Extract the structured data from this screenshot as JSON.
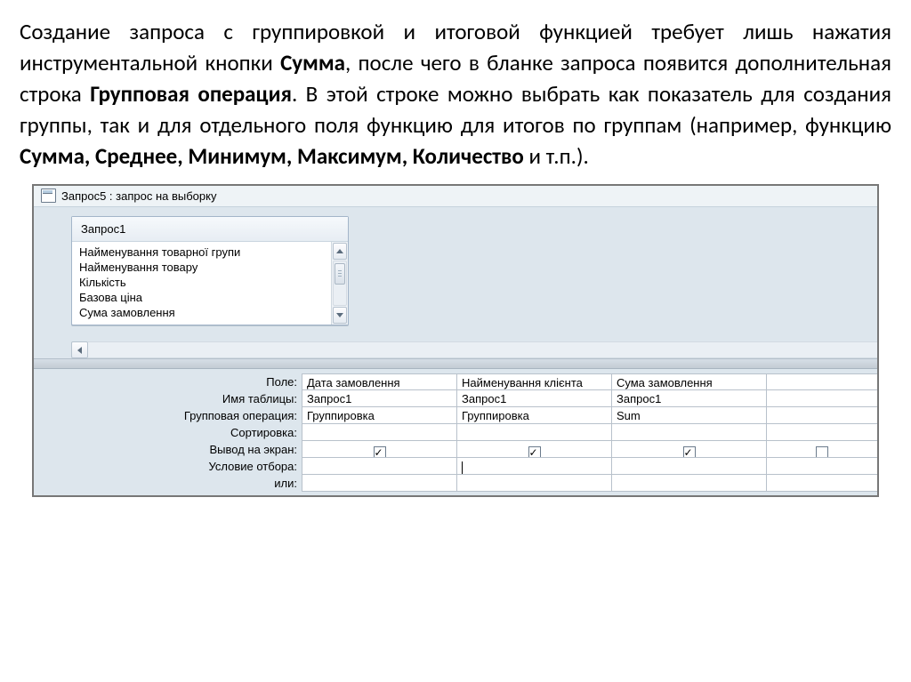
{
  "paragraph": {
    "p1": "Создание запроса с группировкой и итоговой функцией требует лишь нажатия инструментальной кнопки ",
    "b1": "Сумма",
    "p2": ", после чего в бланке запроса появится дополнительная строка ",
    "b2": "Групповая операция",
    "p3": ". В этой строке можно выбрать как показатель для создания группы, так и для отдельного поля функцию для итогов по группам (например, функцию ",
    "b3": "Сумма, Среднее, Минимум, Максимум, Количество",
    "p4": " и т.п.)."
  },
  "window": {
    "title": "Запрос5 : запрос на выборку"
  },
  "source": {
    "header": "Запрос1",
    "fields": [
      "Найменування товарної групи",
      "Найменування товару",
      "Кількість",
      "Базова ціна",
      "Сума замовлення"
    ]
  },
  "gridLabels": {
    "field": "Поле:",
    "table": "Имя таблицы:",
    "groupOp": "Групповая операция:",
    "sort": "Сортировка:",
    "show": "Вывод на экран:",
    "criteria": "Условие отбора:",
    "or": "или:"
  },
  "columns": [
    {
      "field": "Дата замовлення",
      "table": "Запрос1",
      "groupOp": "Группировка",
      "sort": "",
      "show": true,
      "criteria": "",
      "or": ""
    },
    {
      "field": "Найменування клієнта",
      "table": "Запрос1",
      "groupOp": "Группировка",
      "sort": "",
      "show": true,
      "criteria": "",
      "or": ""
    },
    {
      "field": "Сума замовлення",
      "table": "Запрос1",
      "groupOp": "Sum",
      "sort": "",
      "show": true,
      "criteria": "",
      "or": ""
    }
  ]
}
